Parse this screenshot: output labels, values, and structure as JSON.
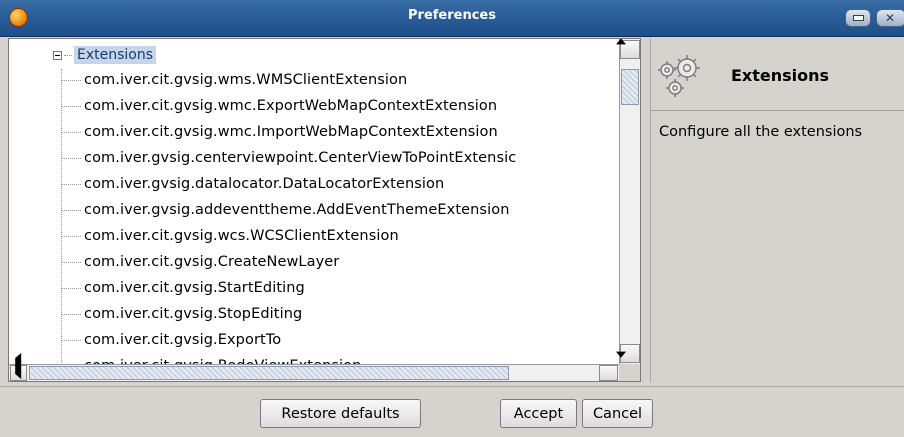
{
  "window": {
    "title": "Preferences"
  },
  "tree": {
    "root": "Extensions",
    "items": [
      "com.iver.cit.gvsig.wms.WMSClientExtension",
      "com.iver.cit.gvsig.wmc.ExportWebMapContextExtension",
      "com.iver.cit.gvsig.wmc.ImportWebMapContextExtension",
      "com.iver.gvsig.centerviewpoint.CenterViewToPointExtensic",
      "com.iver.gvsig.datalocator.DataLocatorExtension",
      "com.iver.gvsig.addeventtheme.AddEventThemeExtension",
      "com.iver.cit.gvsig.wcs.WCSClientExtension",
      "com.iver.cit.gvsig.CreateNewLayer",
      "com.iver.cit.gvsig.StartEditing",
      "com.iver.cit.gvsig.StopEditing",
      "com.iver.cit.gvsig.ExportTo",
      "com.iver.cit.gvsig.RedoViewExtension"
    ]
  },
  "panel": {
    "title": "Extensions",
    "description": "Configure all the extensions",
    "icon": "gears-icon"
  },
  "buttons": {
    "restore": "Restore defaults",
    "accept": "Accept",
    "cancel": "Cancel"
  },
  "colors": {
    "titlebar": "#2a5d9a",
    "selection": "#c6d6ea"
  }
}
